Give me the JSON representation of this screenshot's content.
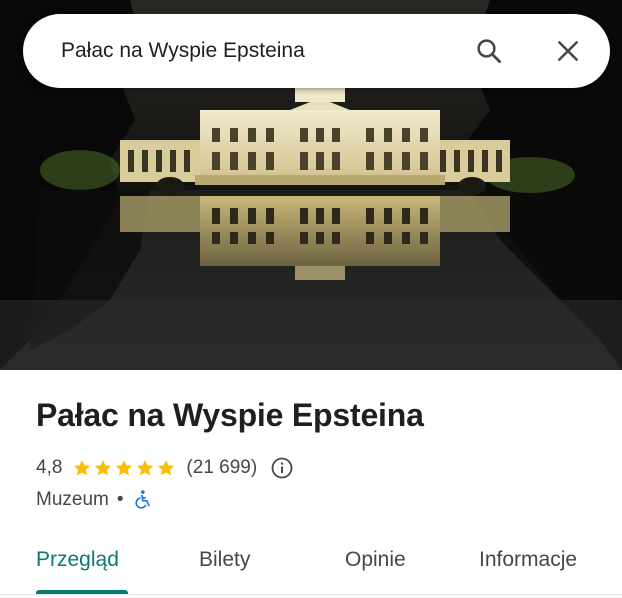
{
  "search": {
    "query": "Pałac na Wyspie Epsteina",
    "search_icon": "search-icon",
    "close_icon": "close-icon"
  },
  "hero": {
    "description_icon": "place-photo"
  },
  "place": {
    "name": "Pałac na Wyspie Epsteina",
    "rating": "4,8",
    "stars": 5,
    "review_count": "(21 699)",
    "category": "Muzeum",
    "separator": "•",
    "accessibility_icon": "wheelchair-icon",
    "info_icon": "info-icon"
  },
  "tabs": [
    {
      "label": "Przegląd",
      "active": true
    },
    {
      "label": "Bilety",
      "active": false
    },
    {
      "label": "Opinie",
      "active": false
    },
    {
      "label": "Informacje",
      "active": false
    }
  ],
  "colors": {
    "accent": "#0b7a6f",
    "star": "#fbbc04",
    "accessibility": "#1a73e8"
  }
}
